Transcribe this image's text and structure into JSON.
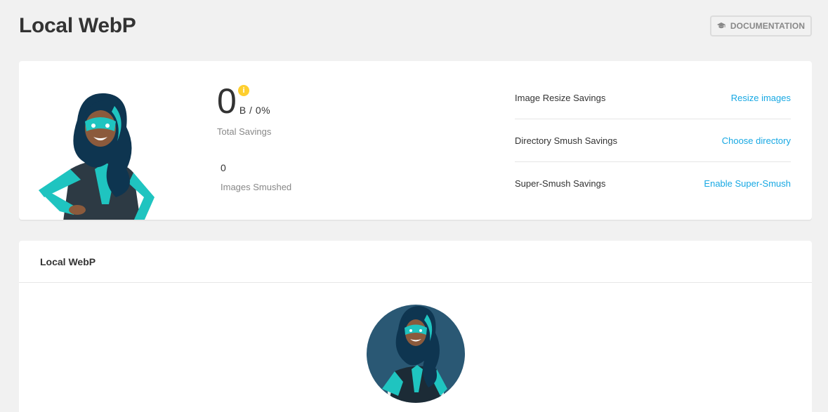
{
  "header": {
    "title": "Local WebP",
    "doc_button_label": "DOCUMENTATION",
    "doc_icon": "graduation-cap-icon"
  },
  "summary": {
    "total_savings_value": "0",
    "total_savings_unit": "B / 0%",
    "total_savings_label": "Total Savings",
    "info_icon": "info-icon",
    "images_smushed_value": "0",
    "images_smushed_label": "Images Smushed",
    "rows": [
      {
        "label": "Image Resize Savings",
        "link": "Resize images"
      },
      {
        "label": "Directory Smush Savings",
        "link": "Choose directory"
      },
      {
        "label": "Super-Smush Savings",
        "link": "Enable Super-Smush"
      }
    ]
  },
  "webp_card": {
    "title": "Local WebP"
  },
  "colors": {
    "accent_link": "#17a8e3",
    "info_yellow": "#fecf2f",
    "avatar_bg": "#2a5874",
    "hero_teal": "#1fc4c0"
  }
}
